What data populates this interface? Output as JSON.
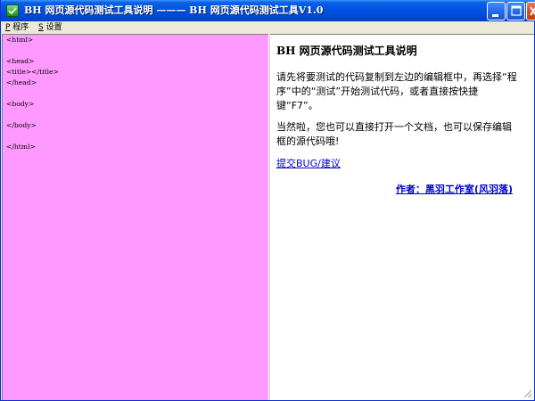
{
  "window": {
    "title": "BH 网页源代码测试工具说明  ——— BH 网页源代码测试工具V1.0"
  },
  "menu": {
    "items": [
      {
        "hotkey": "P",
        "label": " 程序"
      },
      {
        "hotkey": "S",
        "label": " 设置"
      }
    ]
  },
  "editor": {
    "lines": [
      "<html>",
      "",
      "<head>",
      "<title></title>",
      "</head>",
      "",
      "<body>",
      "",
      "</body>",
      "",
      "</html>"
    ],
    "background": "#FF99FF"
  },
  "help": {
    "title": "BH 网页源代码测试工具说明",
    "paragraph1": "请先将要测试的代码复制到左边的编辑框中，再选择“程序”中的“测试”开始测试代码，或者直接按快捷键“F7”。",
    "paragraph2": "当然啦，您也可以直接打开一个文档，也可以保存编辑框的源代码哦!",
    "feedback_link": "提交BUG/建议",
    "author_link": "作者：黑羽工作室(风羽落)"
  },
  "colors": {
    "titlebar": "#0054E3",
    "close_button": "#D44A25",
    "link": "#0000CC"
  },
  "icons": {
    "app": "app-icon",
    "minimize": "minimize-icon",
    "maximize": "maximize-icon",
    "close": "close-icon"
  }
}
